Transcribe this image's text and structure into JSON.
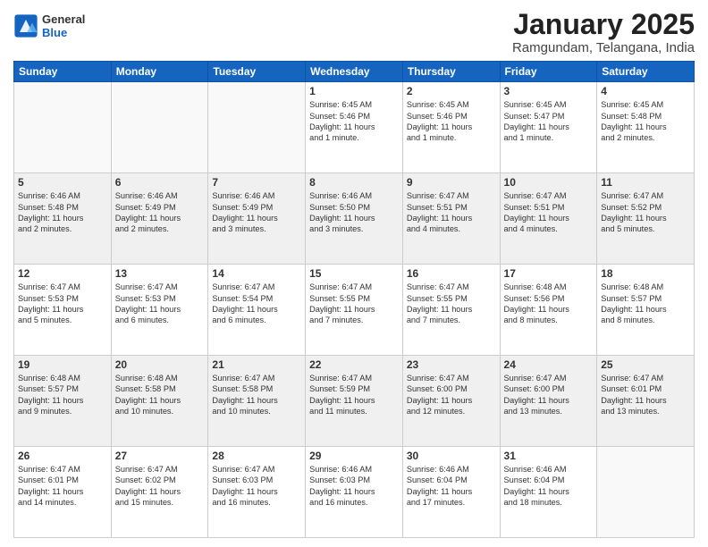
{
  "header": {
    "logo_general": "General",
    "logo_blue": "Blue",
    "month_title": "January 2025",
    "location": "Ramgundam, Telangana, India"
  },
  "days_of_week": [
    "Sunday",
    "Monday",
    "Tuesday",
    "Wednesday",
    "Thursday",
    "Friday",
    "Saturday"
  ],
  "weeks": [
    [
      {
        "day": "",
        "info": ""
      },
      {
        "day": "",
        "info": ""
      },
      {
        "day": "",
        "info": ""
      },
      {
        "day": "1",
        "info": "Sunrise: 6:45 AM\nSunset: 5:46 PM\nDaylight: 11 hours\nand 1 minute."
      },
      {
        "day": "2",
        "info": "Sunrise: 6:45 AM\nSunset: 5:46 PM\nDaylight: 11 hours\nand 1 minute."
      },
      {
        "day": "3",
        "info": "Sunrise: 6:45 AM\nSunset: 5:47 PM\nDaylight: 11 hours\nand 1 minute."
      },
      {
        "day": "4",
        "info": "Sunrise: 6:45 AM\nSunset: 5:48 PM\nDaylight: 11 hours\nand 2 minutes."
      }
    ],
    [
      {
        "day": "5",
        "info": "Sunrise: 6:46 AM\nSunset: 5:48 PM\nDaylight: 11 hours\nand 2 minutes."
      },
      {
        "day": "6",
        "info": "Sunrise: 6:46 AM\nSunset: 5:49 PM\nDaylight: 11 hours\nand 2 minutes."
      },
      {
        "day": "7",
        "info": "Sunrise: 6:46 AM\nSunset: 5:49 PM\nDaylight: 11 hours\nand 3 minutes."
      },
      {
        "day": "8",
        "info": "Sunrise: 6:46 AM\nSunset: 5:50 PM\nDaylight: 11 hours\nand 3 minutes."
      },
      {
        "day": "9",
        "info": "Sunrise: 6:47 AM\nSunset: 5:51 PM\nDaylight: 11 hours\nand 4 minutes."
      },
      {
        "day": "10",
        "info": "Sunrise: 6:47 AM\nSunset: 5:51 PM\nDaylight: 11 hours\nand 4 minutes."
      },
      {
        "day": "11",
        "info": "Sunrise: 6:47 AM\nSunset: 5:52 PM\nDaylight: 11 hours\nand 5 minutes."
      }
    ],
    [
      {
        "day": "12",
        "info": "Sunrise: 6:47 AM\nSunset: 5:53 PM\nDaylight: 11 hours\nand 5 minutes."
      },
      {
        "day": "13",
        "info": "Sunrise: 6:47 AM\nSunset: 5:53 PM\nDaylight: 11 hours\nand 6 minutes."
      },
      {
        "day": "14",
        "info": "Sunrise: 6:47 AM\nSunset: 5:54 PM\nDaylight: 11 hours\nand 6 minutes."
      },
      {
        "day": "15",
        "info": "Sunrise: 6:47 AM\nSunset: 5:55 PM\nDaylight: 11 hours\nand 7 minutes."
      },
      {
        "day": "16",
        "info": "Sunrise: 6:47 AM\nSunset: 5:55 PM\nDaylight: 11 hours\nand 7 minutes."
      },
      {
        "day": "17",
        "info": "Sunrise: 6:48 AM\nSunset: 5:56 PM\nDaylight: 11 hours\nand 8 minutes."
      },
      {
        "day": "18",
        "info": "Sunrise: 6:48 AM\nSunset: 5:57 PM\nDaylight: 11 hours\nand 8 minutes."
      }
    ],
    [
      {
        "day": "19",
        "info": "Sunrise: 6:48 AM\nSunset: 5:57 PM\nDaylight: 11 hours\nand 9 minutes."
      },
      {
        "day": "20",
        "info": "Sunrise: 6:48 AM\nSunset: 5:58 PM\nDaylight: 11 hours\nand 10 minutes."
      },
      {
        "day": "21",
        "info": "Sunrise: 6:47 AM\nSunset: 5:58 PM\nDaylight: 11 hours\nand 10 minutes."
      },
      {
        "day": "22",
        "info": "Sunrise: 6:47 AM\nSunset: 5:59 PM\nDaylight: 11 hours\nand 11 minutes."
      },
      {
        "day": "23",
        "info": "Sunrise: 6:47 AM\nSunset: 6:00 PM\nDaylight: 11 hours\nand 12 minutes."
      },
      {
        "day": "24",
        "info": "Sunrise: 6:47 AM\nSunset: 6:00 PM\nDaylight: 11 hours\nand 13 minutes."
      },
      {
        "day": "25",
        "info": "Sunrise: 6:47 AM\nSunset: 6:01 PM\nDaylight: 11 hours\nand 13 minutes."
      }
    ],
    [
      {
        "day": "26",
        "info": "Sunrise: 6:47 AM\nSunset: 6:01 PM\nDaylight: 11 hours\nand 14 minutes."
      },
      {
        "day": "27",
        "info": "Sunrise: 6:47 AM\nSunset: 6:02 PM\nDaylight: 11 hours\nand 15 minutes."
      },
      {
        "day": "28",
        "info": "Sunrise: 6:47 AM\nSunset: 6:03 PM\nDaylight: 11 hours\nand 16 minutes."
      },
      {
        "day": "29",
        "info": "Sunrise: 6:46 AM\nSunset: 6:03 PM\nDaylight: 11 hours\nand 16 minutes."
      },
      {
        "day": "30",
        "info": "Sunrise: 6:46 AM\nSunset: 6:04 PM\nDaylight: 11 hours\nand 17 minutes."
      },
      {
        "day": "31",
        "info": "Sunrise: 6:46 AM\nSunset: 6:04 PM\nDaylight: 11 hours\nand 18 minutes."
      },
      {
        "day": "",
        "info": ""
      }
    ]
  ]
}
